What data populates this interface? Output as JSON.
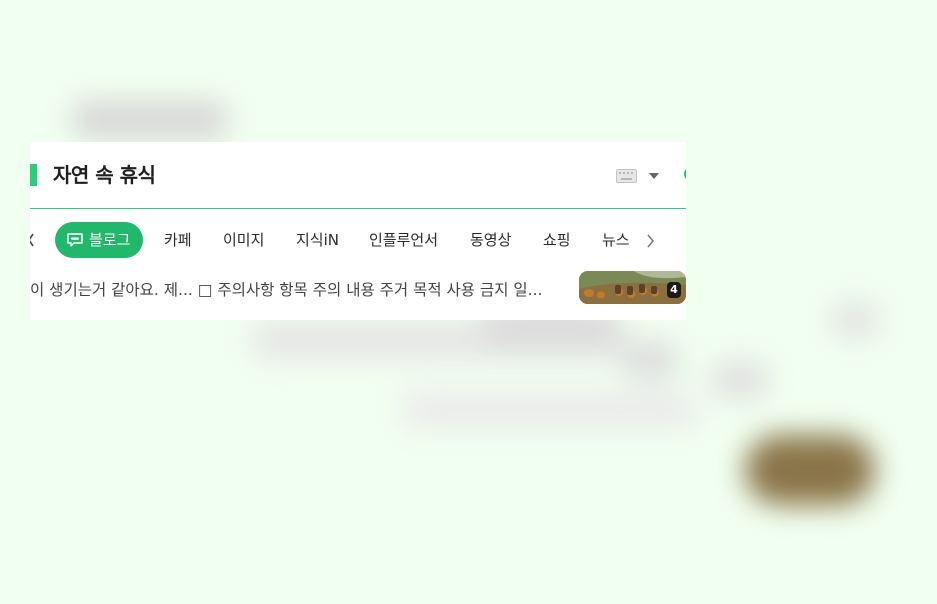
{
  "search": {
    "query": "자연 속 휴식"
  },
  "tabs": {
    "items": [
      {
        "label": "블로그",
        "active": true
      },
      {
        "label": "카페"
      },
      {
        "label": "이미지"
      },
      {
        "label": "지식iN"
      },
      {
        "label": "인플루언서"
      },
      {
        "label": "동영상"
      },
      {
        "label": "쇼핑"
      },
      {
        "label": "뉴스"
      }
    ]
  },
  "result": {
    "snippet": "이 생기는거 같아요. 제... □ 주의사항 항목 주의 내용 주거 목적 사용 금지 일...",
    "image_count": "4"
  },
  "colors": {
    "page_background": "#f1fff0",
    "accent_green": "#24d07a",
    "active_tab": "#22b86c"
  },
  "icons": [
    "keyboard-icon",
    "dropdown-arrow-icon",
    "blog-bubble-icon",
    "chevron-left-icon",
    "chevron-right-icon"
  ]
}
